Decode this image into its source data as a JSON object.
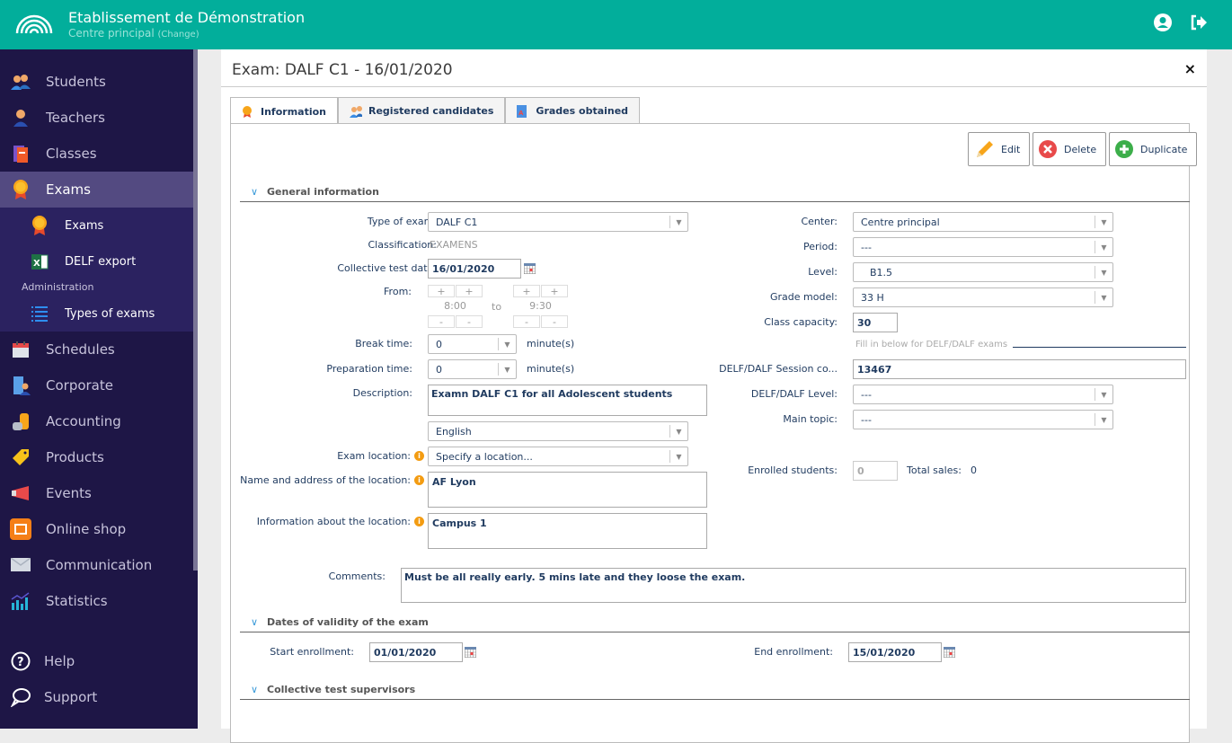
{
  "header": {
    "title": "Etablissement de Démonstration",
    "subtitle": "Centre principal",
    "change_label": "(Change)",
    "icons": [
      "user-icon",
      "logout-icon"
    ],
    "brand_color": "#02ae9b"
  },
  "sidebar": {
    "items": [
      {
        "label": "Students",
        "icon": "students-icon"
      },
      {
        "label": "Teachers",
        "icon": "teacher-icon"
      },
      {
        "label": "Classes",
        "icon": "book-icon"
      },
      {
        "label": "Exams",
        "icon": "medal-icon",
        "active": true
      },
      {
        "label": "Schedules",
        "icon": "calendar-icon"
      },
      {
        "label": "Corporate",
        "icon": "building-icon"
      },
      {
        "label": "Accounting",
        "icon": "coins-icon"
      },
      {
        "label": "Products",
        "icon": "tag-icon"
      },
      {
        "label": "Events",
        "icon": "megaphone-icon"
      },
      {
        "label": "Online shop",
        "icon": "shop-icon"
      },
      {
        "label": "Communication",
        "icon": "envelope-icon"
      },
      {
        "label": "Statistics",
        "icon": "chart-icon"
      }
    ],
    "sub_items": [
      {
        "label": "Exams",
        "icon": "medal-icon"
      },
      {
        "label": "DELF export",
        "icon": "excel-icon"
      },
      {
        "label": "Types of exams",
        "icon": "list-icon"
      }
    ],
    "admin_label": "Administration",
    "help": "Help",
    "support": "Support"
  },
  "panel": {
    "title": "Exam: DALF C1 - 16/01/2020",
    "close": "×",
    "tabs": [
      {
        "label": "Information",
        "active": true
      },
      {
        "label": "Registered candidates"
      },
      {
        "label": "Grades obtained"
      }
    ],
    "actions": {
      "edit": "Edit",
      "delete": "Delete",
      "duplicate": "Duplicate"
    },
    "sections": {
      "general": "General information",
      "validity": "Dates of validity of the exam",
      "supervisors": "Collective test supervisors"
    },
    "left": {
      "type_label": "Type of exam:",
      "type_value": "DALF C1",
      "classification_label": "Classification:",
      "classification_value": "EXAMENS",
      "date_label": "Collective test date:",
      "date_value": "16/01/2020",
      "from_label": "From:",
      "from_value": "8:00",
      "to_label": "to",
      "to_value": "9:30",
      "plus": "+",
      "minus": "-",
      "break_label": "Break time:",
      "break_value": "0",
      "prep_label": "Preparation time:",
      "prep_value": "0",
      "minutes": "minute(s)",
      "desc_label": "Description:",
      "desc_value": "Examn DALF C1 for all Adolescent students",
      "language_value": "English",
      "location_label": "Exam location:",
      "location_value": "Specify a location...",
      "address_label": "Name and address of the location:",
      "address_value": "AF Lyon",
      "locinfo_label": "Information about the location:",
      "locinfo_value": "Campus 1",
      "info_glyph": "i"
    },
    "right": {
      "center_label": "Center:",
      "center_value": "Centre principal",
      "period_label": "Period:",
      "period_value": "---",
      "level_label": "Level:",
      "level_value": "B1.5",
      "grade_label": "Grade model:",
      "grade_value": "33 H",
      "capacity_label": "Class capacity:",
      "capacity_value": "30",
      "delf_hint": "Fill in below for DELF/DALF exams",
      "session_label": "DELF/DALF Session co...",
      "session_value": "13467",
      "delf_level_label": "DELF/DALF Level:",
      "delf_level_value": "---",
      "topic_label": "Main topic:",
      "topic_value": "---",
      "enrolled_label": "Enrolled students:",
      "enrolled_value": "0",
      "sales_label": "Total sales:",
      "sales_value": "0"
    },
    "comments_label": "Comments:",
    "comments_value": "Must be all really early. 5 mins late and they loose the exam.",
    "start_label": "Start enrollment:",
    "start_value": "01/01/2020",
    "end_label": "End enrollment:",
    "end_value": "15/01/2020"
  }
}
